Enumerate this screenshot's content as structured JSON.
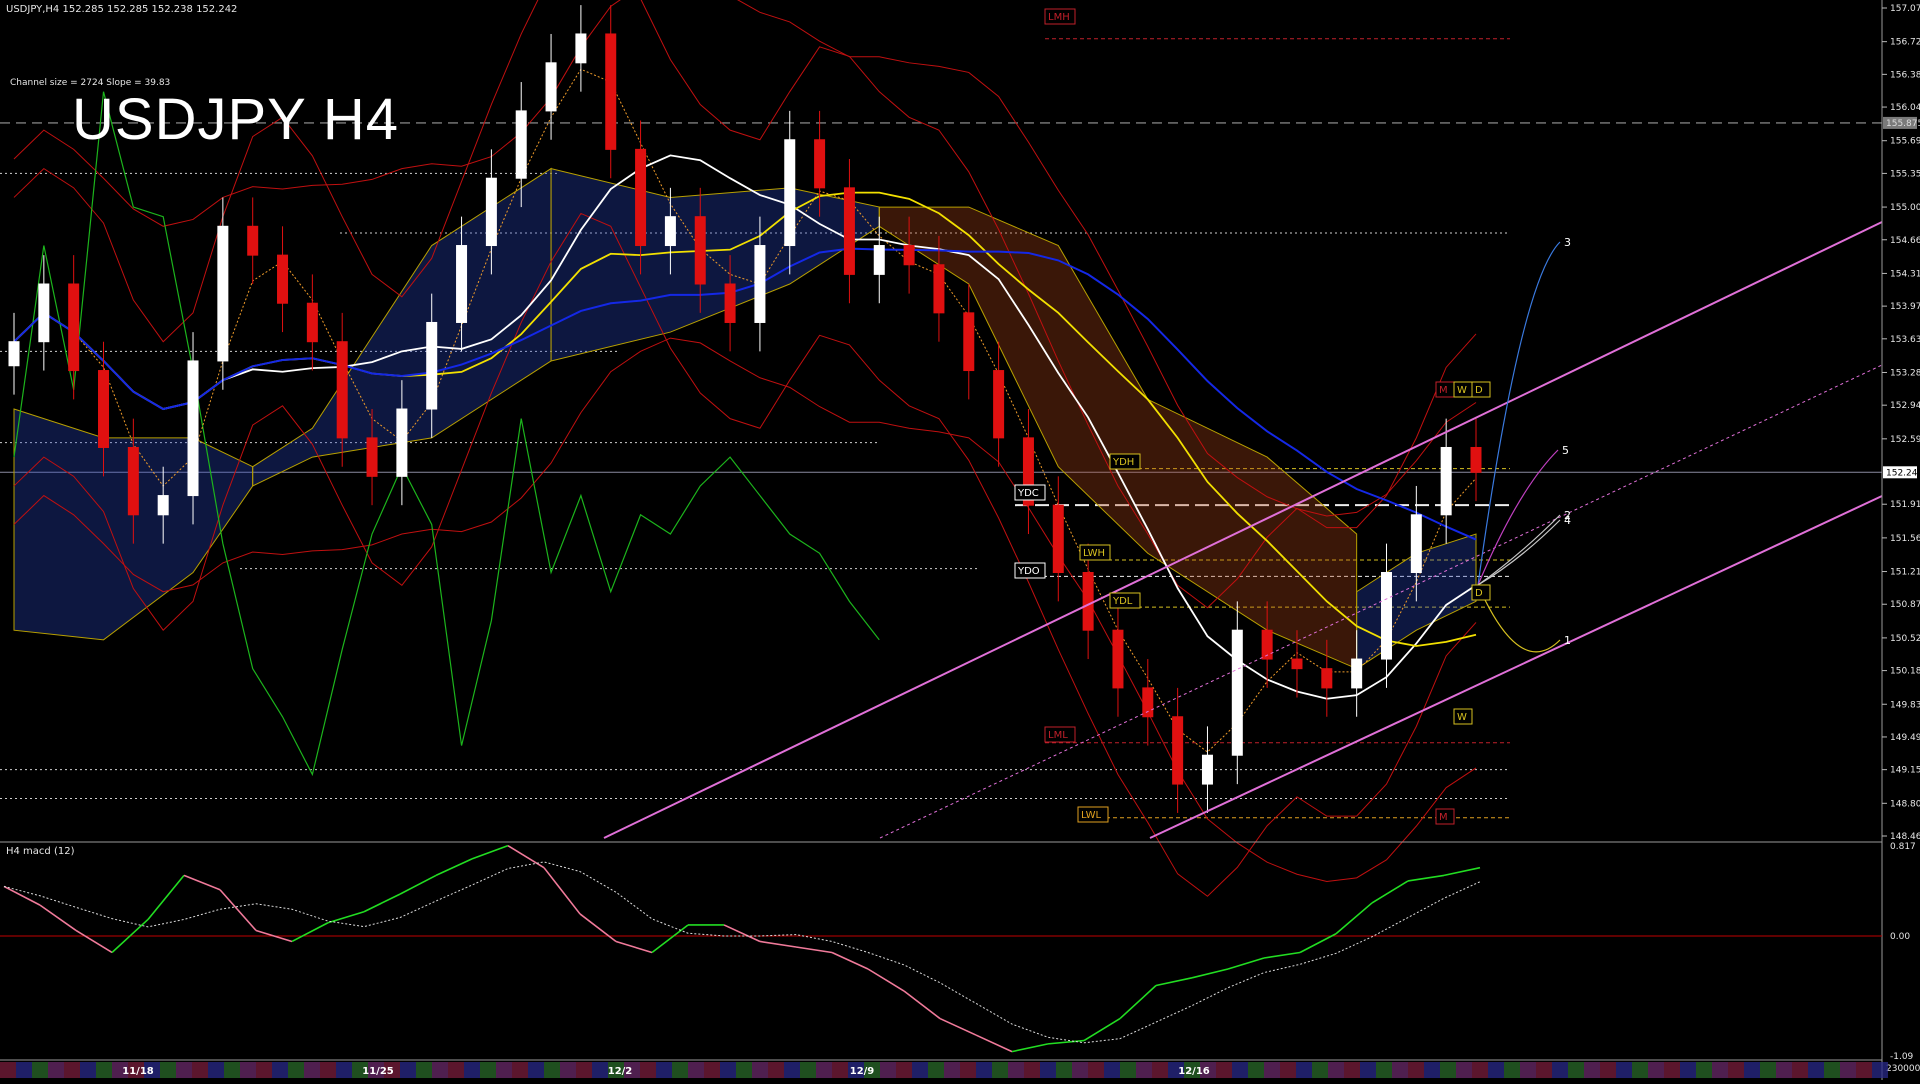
{
  "header": {
    "symbol_line": "USDJPY,H4  152.285 152.285 152.238 152.242",
    "channel_info": "Channel size = 2724 Slope = 39.83",
    "big_title": "USDJPY H4"
  },
  "colors": {
    "background": "#000000",
    "bull_candle": "#ffffff",
    "bear_candle": "#e01010",
    "ma_white": "#ffffff",
    "ma_yellow": "#f2e000",
    "ma_blue": "#1428e6",
    "bollinger": "#c01010",
    "green_line": "#1cb41c",
    "channel": "#e070d8",
    "cloud_red": "#b44818",
    "cloud_blue": "#2848c8",
    "macd_line": "#22dd22",
    "macd_negative": "#f07a9a",
    "zero_line": "#c00000"
  },
  "price_axis": {
    "ticks": [
      "157.070",
      "156.720",
      "156.380",
      "156.040",
      "155.690",
      "155.350",
      "155.000",
      "154.660",
      "154.310",
      "153.970",
      "153.630",
      "153.280",
      "152.940",
      "152.590",
      "151.910",
      "151.560",
      "151.210",
      "150.870",
      "150.520",
      "150.180",
      "149.830",
      "149.490",
      "149.150",
      "148.800",
      "148.460"
    ],
    "current_price": "152.242",
    "marked_price": "155.875"
  },
  "macd_panel": {
    "label": "H4  macd (12)",
    "ticks": [
      "0.817",
      "0.00",
      "-1.09"
    ],
    "bottom_value": "230000"
  },
  "time_axis": {
    "dates": [
      "11/18",
      "11/25",
      "12/2",
      "12/9",
      "12/16"
    ]
  },
  "level_labels": [
    "LMH",
    "YDH",
    "YDC",
    "YDO",
    "LWH",
    "YDL",
    "LML",
    "LWL",
    "M",
    "W",
    "D",
    "D",
    "W",
    "M"
  ],
  "projection_labels": [
    "3",
    "5",
    "2",
    "4",
    "1"
  ],
  "chart_data": {
    "type": "candlestick",
    "symbol": "USDJPY",
    "timeframe": "H4",
    "ylim": [
      148.46,
      157.07
    ],
    "last_price": 152.242,
    "dates": [
      "11/18",
      "11/25",
      "12/2",
      "12/9",
      "12/16"
    ],
    "levels": [
      {
        "label": "LMH",
        "value": 156.75
      },
      {
        "label": "YDH",
        "value": 152.28
      },
      {
        "label": "YDC",
        "value": 151.9
      },
      {
        "label": "YDO",
        "value": 151.16
      },
      {
        "label": "LWH",
        "value": 151.33
      },
      {
        "label": "YDL",
        "value": 150.84
      },
      {
        "label": "LML",
        "value": 149.43
      },
      {
        "label": "LWL",
        "value": 148.65
      }
    ],
    "close_series": [
      {
        "date": "11/18",
        "value": 153.6
      },
      {
        "value": 154.2
      },
      {
        "value": 153.3
      },
      {
        "value": 152.5
      },
      {
        "value": 151.8
      },
      {
        "value": 152.0
      },
      {
        "value": 153.4
      },
      {
        "value": 154.8
      },
      {
        "value": 154.5
      },
      {
        "value": 154.0
      },
      {
        "date": "11/25",
        "value": 153.6
      },
      {
        "value": 152.6
      },
      {
        "value": 152.2
      },
      {
        "value": 152.9
      },
      {
        "value": 153.8
      },
      {
        "value": 154.6
      },
      {
        "value": 155.3
      },
      {
        "value": 156.0
      },
      {
        "value": 156.5
      },
      {
        "value": 156.8
      },
      {
        "date": "12/2",
        "value": 155.6
      },
      {
        "value": 154.6
      },
      {
        "value": 154.9
      },
      {
        "value": 154.2
      },
      {
        "value": 153.8
      },
      {
        "value": 154.6
      },
      {
        "value": 155.7
      },
      {
        "value": 155.2
      },
      {
        "value": 154.3
      },
      {
        "value": 154.6
      },
      {
        "date": "12/9",
        "value": 154.4
      },
      {
        "value": 153.9
      },
      {
        "value": 153.3
      },
      {
        "value": 152.6
      },
      {
        "value": 151.9
      },
      {
        "value": 151.2
      },
      {
        "value": 150.6
      },
      {
        "value": 150.0
      },
      {
        "value": 149.7
      },
      {
        "value": 149.0
      },
      {
        "date": "12/16",
        "value": 149.3
      },
      {
        "value": 150.6
      },
      {
        "value": 150.3
      },
      {
        "value": 150.2
      },
      {
        "value": 150.0
      },
      {
        "value": 150.3
      },
      {
        "value": 151.2
      },
      {
        "value": 151.8
      },
      {
        "value": 152.5
      },
      {
        "value": 152.242
      }
    ],
    "macd": [
      {
        "value": 0.45
      },
      {
        "value": 0.28
      },
      {
        "value": 0.05
      },
      {
        "value": -0.15
      },
      {
        "value": 0.15
      },
      {
        "value": 0.55
      },
      {
        "value": 0.42
      },
      {
        "value": 0.05
      },
      {
        "value": -0.05
      },
      {
        "value": 0.12
      },
      {
        "value": 0.22
      },
      {
        "value": 0.38
      },
      {
        "value": 0.55
      },
      {
        "value": 0.7
      },
      {
        "value": 0.82
      },
      {
        "value": 0.62
      },
      {
        "value": 0.2
      },
      {
        "value": -0.05
      },
      {
        "value": -0.15
      },
      {
        "value": 0.1
      },
      {
        "value": 0.1
      },
      {
        "value": -0.05
      },
      {
        "value": -0.1
      },
      {
        "value": -0.15
      },
      {
        "value": -0.3
      },
      {
        "value": -0.5
      },
      {
        "value": -0.75
      },
      {
        "value": -0.9
      },
      {
        "value": -1.05
      },
      {
        "value": -0.98
      },
      {
        "value": -0.95
      },
      {
        "value": -0.75
      },
      {
        "value": -0.45
      },
      {
        "value": -0.38
      },
      {
        "value": -0.3
      },
      {
        "value": -0.2
      },
      {
        "value": -0.15
      },
      {
        "value": 0.02
      },
      {
        "value": 0.3
      },
      {
        "value": 0.5
      },
      {
        "value": 0.55
      },
      {
        "value": 0.62
      }
    ]
  }
}
